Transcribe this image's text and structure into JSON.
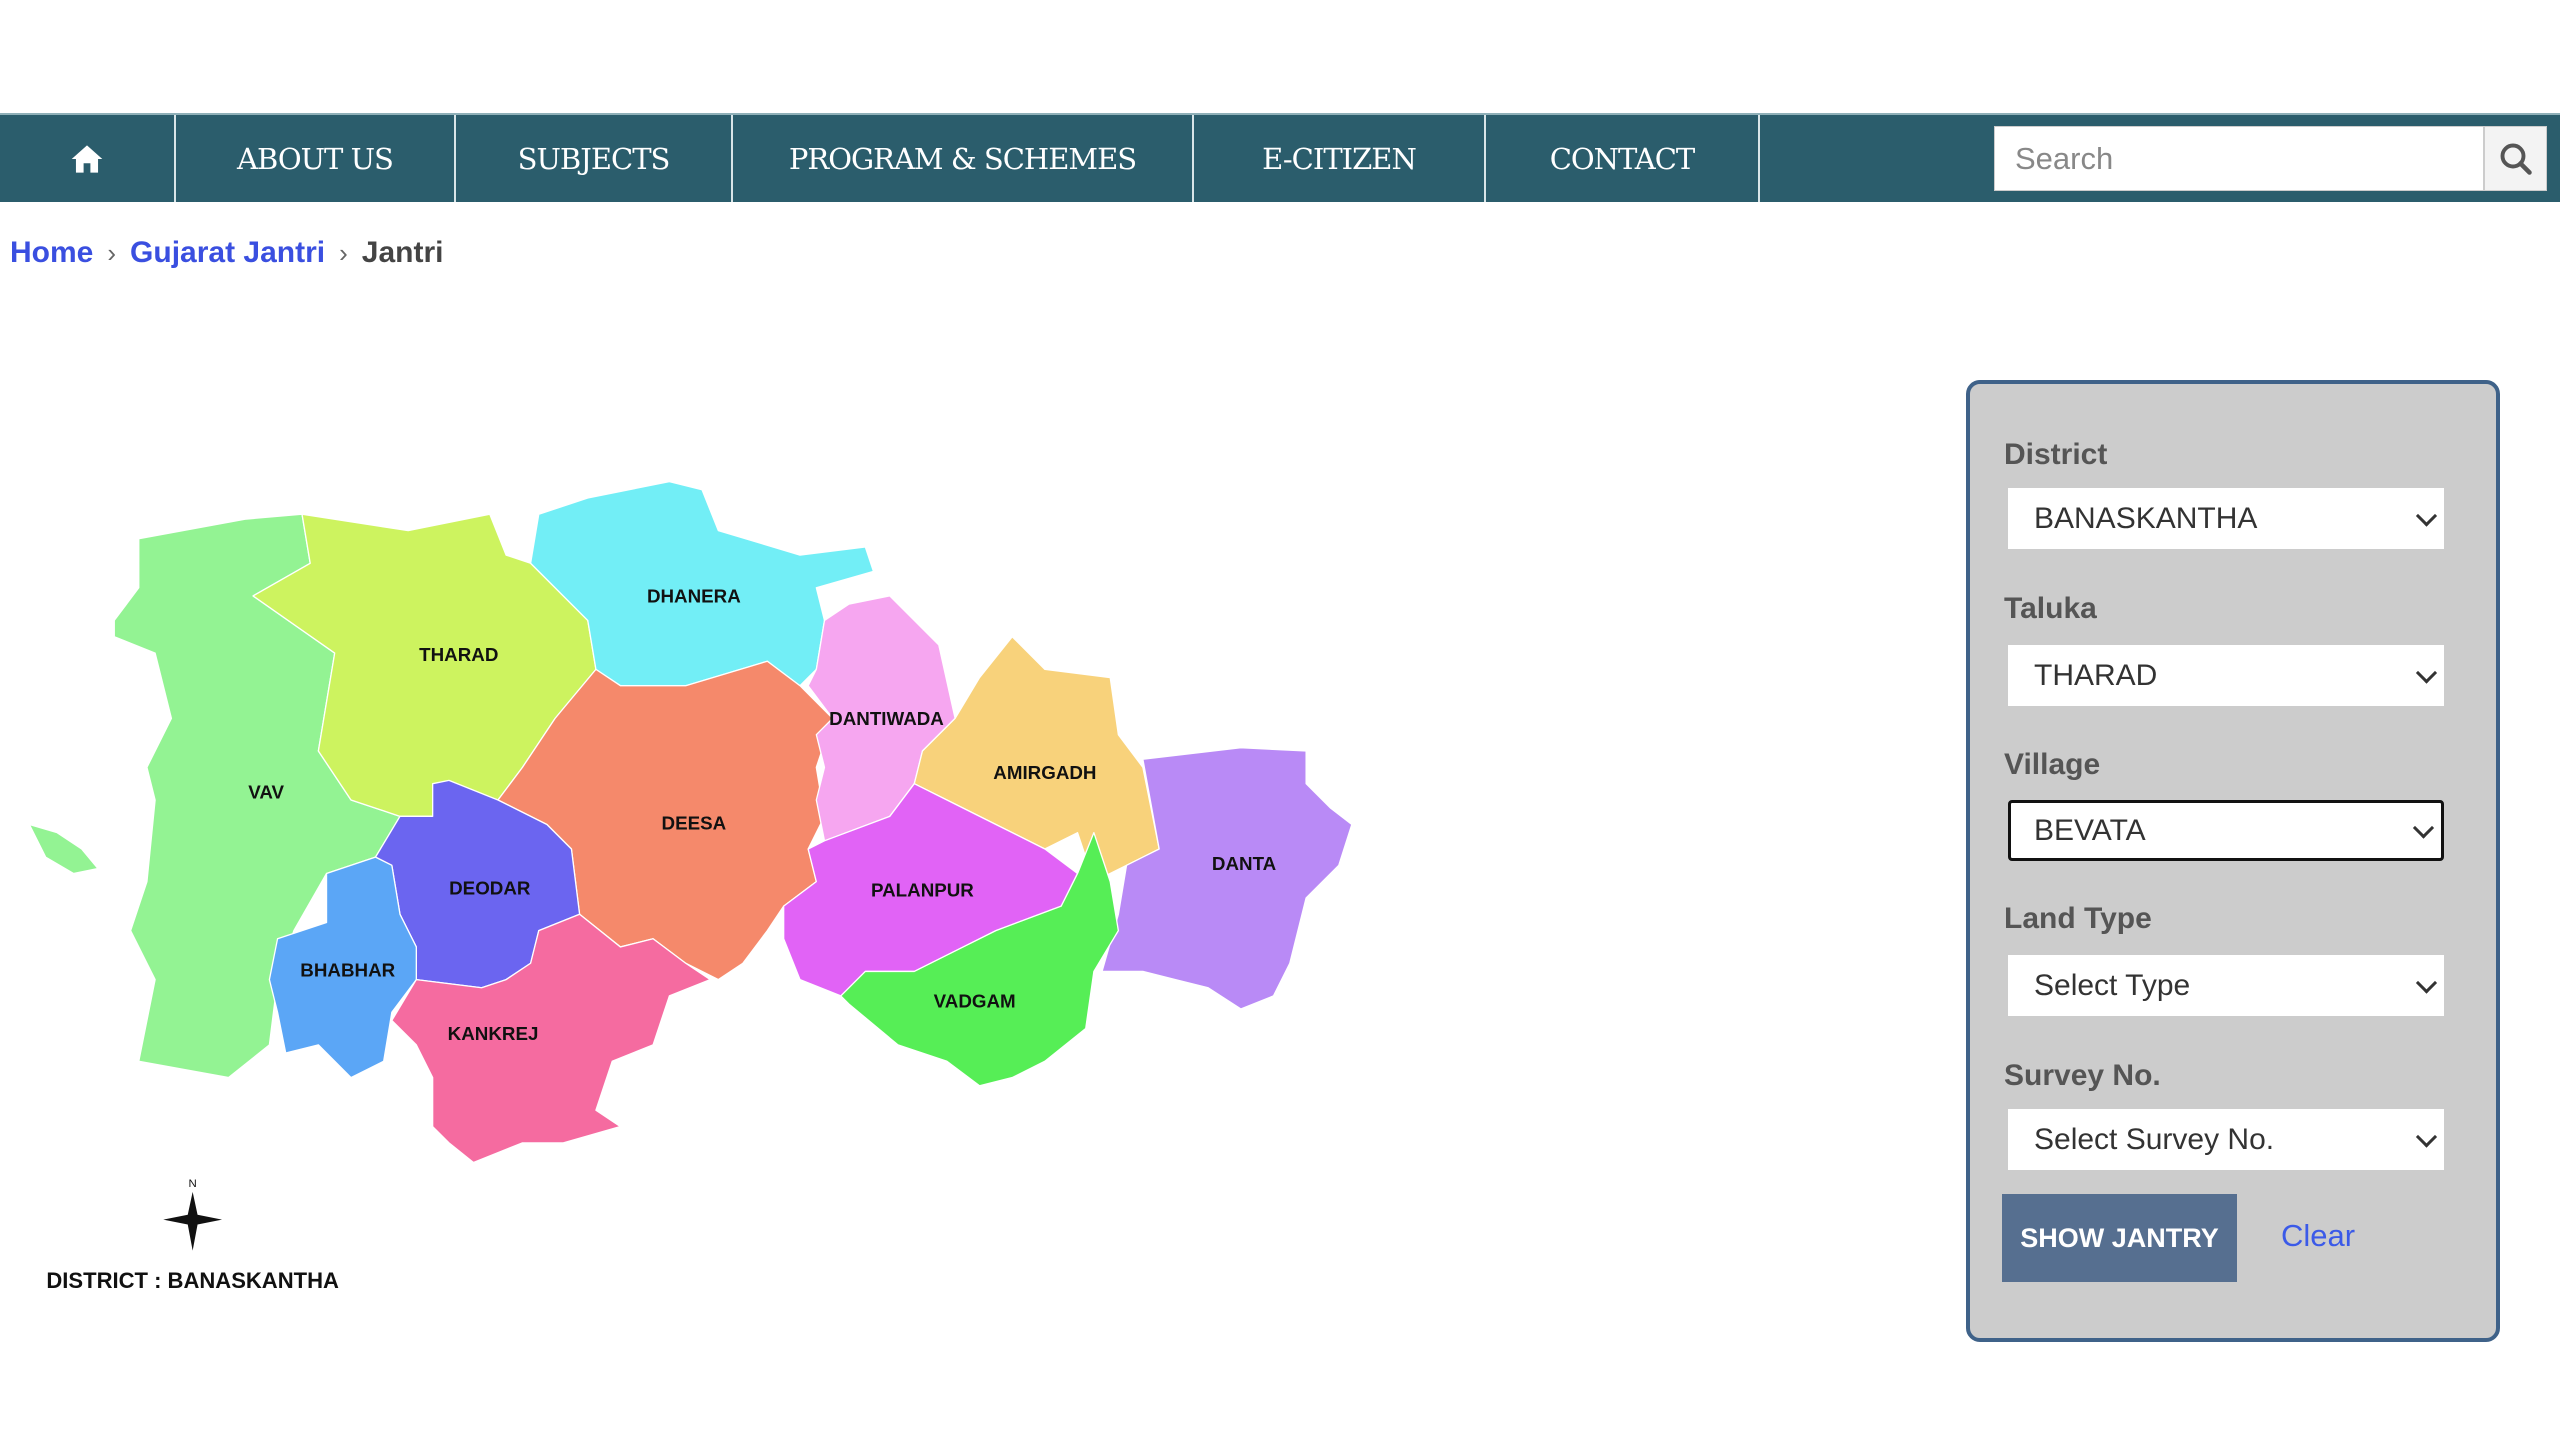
{
  "nav": {
    "home_icon": "home-icon",
    "items": [
      {
        "label": "ABOUT US"
      },
      {
        "label": "SUBJECTS"
      },
      {
        "label": "PROGRAM & SCHEMES"
      },
      {
        "label": "E-CITIZEN"
      },
      {
        "label": "CONTACT"
      }
    ],
    "search_placeholder": "Search",
    "search_icon": "search-icon",
    "color": "#2b5d6c"
  },
  "breadcrumb": {
    "items": [
      "Home",
      "Gujarat Jantri"
    ],
    "current": "Jantri"
  },
  "map": {
    "district_caption": "DISTRICT : BANASKANTHA",
    "compass_label": "N",
    "talukas": [
      {
        "name": "VAV",
        "color": "#93f393"
      },
      {
        "name": "THARAD",
        "color": "#cdf35f"
      },
      {
        "name": "DHANERA",
        "color": "#72eef6"
      },
      {
        "name": "DEESA",
        "color": "#f5896b"
      },
      {
        "name": "DANTIWADA",
        "color": "#f6a6f0"
      },
      {
        "name": "AMIRGADH",
        "color": "#f8d27b"
      },
      {
        "name": "DANTA",
        "color": "#b98af6"
      },
      {
        "name": "PALANPUR",
        "color": "#e163f6"
      },
      {
        "name": "VADGAM",
        "color": "#56ee56"
      },
      {
        "name": "DEODAR",
        "color": "#6b65f0"
      },
      {
        "name": "BHABHAR",
        "color": "#5ba6f6"
      },
      {
        "name": "KANKREJ",
        "color": "#f56ba0"
      }
    ]
  },
  "form": {
    "district": {
      "label": "District",
      "value": "BANASKANTHA"
    },
    "taluka": {
      "label": "Taluka",
      "value": "THARAD"
    },
    "village": {
      "label": "Village",
      "value": "BEVATA"
    },
    "land_type": {
      "label": "Land Type",
      "value": "Select Type"
    },
    "survey_no": {
      "label": "Survey No.",
      "value": "Select Survey No."
    },
    "show_button": "SHOW JANTRY",
    "clear_link": "Clear"
  }
}
